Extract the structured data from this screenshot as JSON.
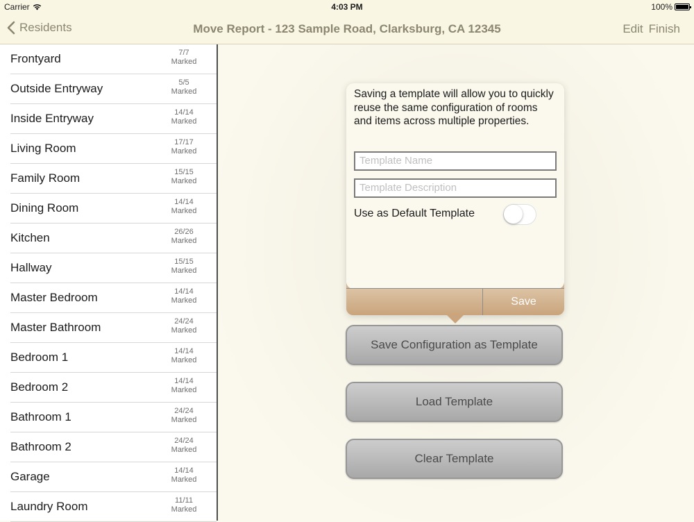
{
  "status": {
    "carrier": "Carrier",
    "time": "4:03 PM",
    "battery": "100%"
  },
  "nav": {
    "back_label": "Residents",
    "title": "Move Report - 123 Sample Road, Clarksburg, CA 12345",
    "edit_label": "Edit",
    "finish_label": "Finish"
  },
  "rooms": [
    {
      "name": "Frontyard",
      "count": "7/7",
      "status": "Marked"
    },
    {
      "name": "Outside Entryway",
      "count": "5/5",
      "status": "Marked"
    },
    {
      "name": "Inside Entryway",
      "count": "14/14",
      "status": "Marked"
    },
    {
      "name": "Living Room",
      "count": "17/17",
      "status": "Marked"
    },
    {
      "name": "Family Room",
      "count": "15/15",
      "status": "Marked"
    },
    {
      "name": "Dining Room",
      "count": "14/14",
      "status": "Marked"
    },
    {
      "name": "Kitchen",
      "count": "26/26",
      "status": "Marked"
    },
    {
      "name": "Hallway",
      "count": "15/15",
      "status": "Marked"
    },
    {
      "name": "Master Bedroom",
      "count": "14/14",
      "status": "Marked"
    },
    {
      "name": "Master Bathroom",
      "count": "24/24",
      "status": "Marked"
    },
    {
      "name": "Bedroom 1",
      "count": "14/14",
      "status": "Marked"
    },
    {
      "name": "Bedroom 2",
      "count": "14/14",
      "status": "Marked"
    },
    {
      "name": "Bathroom 1",
      "count": "24/24",
      "status": "Marked"
    },
    {
      "name": "Bathroom 2",
      "count": "24/24",
      "status": "Marked"
    },
    {
      "name": "Garage",
      "count": "14/14",
      "status": "Marked"
    },
    {
      "name": "Laundry Room",
      "count": "11/11",
      "status": "Marked"
    }
  ],
  "popover": {
    "message": "Saving a template will allow you to quickly reuse the same configuration of rooms and items across multiple properties.",
    "name_placeholder": "Template Name",
    "description_placeholder": "Template Description",
    "default_label": "Use as Default Template",
    "default_on": false,
    "save_label": "Save"
  },
  "buttons": {
    "save_config": "Save Configuration as Template",
    "load": "Load Template",
    "clear": "Clear Template"
  }
}
